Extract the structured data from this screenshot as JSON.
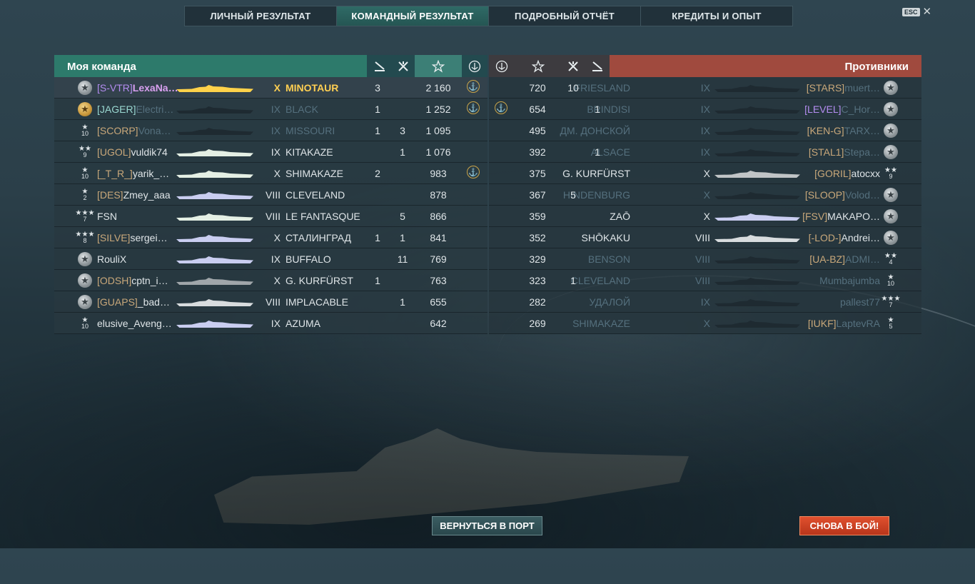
{
  "tabs": [
    {
      "label": "ЛИЧНЫЙ РЕЗУЛЬТАТ",
      "active": false
    },
    {
      "label": "КОМАНДНЫЙ РЕЗУЛЬТАТ",
      "active": true
    },
    {
      "label": "ПОДРОБНЫЙ ОТЧЁТ",
      "active": false
    },
    {
      "label": "КРЕДИТЫ И ОПЫТ",
      "active": false
    }
  ],
  "esc": {
    "key": "ESC",
    "close": "✕"
  },
  "my_team": {
    "title": "Моя команда",
    "columns": [
      "torpedo-hits-icon",
      "planes-shot-icon",
      "star-xp-icon",
      "anchor-icon"
    ],
    "rows": [
      {
        "rank": "",
        "medal": "silver",
        "clan": "[S-VTR]",
        "clan_color": "purple",
        "nick": "LexaNa…",
        "nick_style": "me",
        "ship_color": "#ffd24a",
        "tier": "X",
        "ship": "MINOTAUR",
        "ship_style": "gold",
        "c1": "3",
        "c2": "",
        "xp": "2 160",
        "anchor": true,
        "me": true
      },
      {
        "rank": "",
        "medal": "gold",
        "clan": "[JAGER]",
        "clan_color": "teal",
        "nick": "Electri…",
        "nick_style": "dim",
        "ship_color": "#1e2a31",
        "tier": "IX",
        "ship": "BLACK",
        "ship_style": "dim",
        "c1": "1",
        "c2": "",
        "xp": "1 252",
        "anchor": true
      },
      {
        "rank": "10",
        "medal": "star1",
        "clan": "[SCORP]",
        "clan_color": "orange",
        "nick": "Vona…",
        "nick_style": "dim",
        "ship_color": "#1e2a31",
        "tier": "IX",
        "ship": "MISSOURI",
        "ship_style": "dim",
        "c1": "1",
        "c2": "3",
        "xp": "1 095",
        "anchor": false
      },
      {
        "rank": "9",
        "medal": "star2",
        "clan": "[UGOL]",
        "clan_color": "orange",
        "nick": "vuldik74",
        "nick_style": "",
        "ship_color": "#e4efe4",
        "tier": "IX",
        "ship": "KITAKAZE",
        "ship_style": "",
        "c1": "",
        "c2": "1",
        "xp": "1 076",
        "anchor": false
      },
      {
        "rank": "10",
        "medal": "star1",
        "clan": "[_T_R_]",
        "clan_color": "",
        "nick": "yarik_…",
        "nick_style": "",
        "ship_color": "#e4efe4",
        "tier": "X",
        "ship": "SHIMAKAZE",
        "ship_style": "",
        "c1": "2",
        "c2": "",
        "xp": "983",
        "anchor": true
      },
      {
        "rank": "2",
        "medal": "star1",
        "clan": "[DES]",
        "clan_color": "orange",
        "nick": "Zmey_aaa",
        "nick_style": "",
        "ship_color": "#c9cdf0",
        "tier": "VIII",
        "ship": "CLEVELAND",
        "ship_style": "",
        "c1": "",
        "c2": "",
        "xp": "878",
        "anchor": false
      },
      {
        "rank": "7",
        "medal": "star3",
        "clan": "",
        "clan_color": "",
        "nick": "FSN",
        "nick_style": "",
        "ship_color": "#e4efe4",
        "tier": "VIII",
        "ship": "LE FANTASQUE",
        "ship_style": "",
        "c1": "",
        "c2": "5",
        "xp": "866",
        "anchor": false
      },
      {
        "rank": "8",
        "medal": "star3",
        "clan": "[SILVE]",
        "clan_color": "orange",
        "nick": "sergei…",
        "nick_style": "",
        "ship_color": "#c9cdf0",
        "tier": "X",
        "ship": "СТАЛИНГРАД",
        "ship_style": "",
        "c1": "1",
        "c2": "1",
        "xp": "841",
        "anchor": false
      },
      {
        "rank": "",
        "medal": "silver",
        "clan": "",
        "clan_color": "",
        "nick": "RouliX",
        "nick_style": "",
        "ship_color": "#c9cdf0",
        "tier": "IX",
        "ship": "BUFFALO",
        "ship_style": "",
        "c1": "",
        "c2": "11",
        "xp": "769",
        "anchor": false
      },
      {
        "rank": "",
        "medal": "silver",
        "clan": "[ODSH]",
        "clan_color": "orange",
        "nick": "cptn_i…",
        "nick_style": "",
        "ship_color": "#a0a6aa",
        "tier": "X",
        "ship": "G. KURFÜRST",
        "ship_style": "",
        "c1": "1",
        "c2": "",
        "xp": "763",
        "anchor": false
      },
      {
        "rank": "",
        "medal": "silver",
        "clan": "[GUAPS]",
        "clan_color": "orange",
        "nick": "_bad…",
        "nick_style": "",
        "ship_color": "#d8dcde",
        "tier": "VIII",
        "ship": "IMPLACABLE",
        "ship_style": "",
        "c1": "",
        "c2": "1",
        "xp": "655",
        "anchor": false
      },
      {
        "rank": "10",
        "medal": "star1",
        "clan": "",
        "clan_color": "",
        "nick": "elusive_Aveng…",
        "nick_style": "",
        "ship_color": "#c9cdf0",
        "tier": "IX",
        "ship": "AZUMA",
        "ship_style": "",
        "c1": "",
        "c2": "",
        "xp": "642",
        "anchor": false
      }
    ]
  },
  "enemy_team": {
    "title": "Противники",
    "columns": [
      "anchor-icon",
      "star-xp-icon",
      "planes-shot-icon",
      "torpedo-hits-icon"
    ],
    "rows": [
      {
        "rank": "",
        "medal": "silver",
        "clan": "[STARS]",
        "clan_color": "orange",
        "nick": "muert…",
        "nick_style": "dim",
        "ship_color": "#1e2a31",
        "tier": "IX",
        "ship": "FRIESLAND",
        "ship_style": "dim",
        "c1": "10",
        "c2": "",
        "xp": "720",
        "anchor": false
      },
      {
        "rank": "",
        "medal": "silver",
        "clan": "[LEVEL]",
        "clan_color": "purple",
        "nick": "C_Hor…",
        "nick_style": "dim",
        "ship_color": "#1e2a31",
        "tier": "IX",
        "ship": "BRINDISI",
        "ship_style": "dim",
        "c1": "",
        "c2": "1",
        "xp": "654",
        "anchor": true
      },
      {
        "rank": "",
        "medal": "silver",
        "clan": "[KEN-G]",
        "clan_color": "orange",
        "nick": "TARX…",
        "nick_style": "dim",
        "ship_color": "#1e2a31",
        "tier": "IX",
        "ship": "ДМ. ДОНСКОЙ",
        "ship_style": "dim",
        "c1": "",
        "c2": "",
        "xp": "495",
        "anchor": false
      },
      {
        "rank": "",
        "medal": "silver",
        "clan": "[STAL1]",
        "clan_color": "",
        "nick": "Stepa…",
        "nick_style": "dim",
        "ship_color": "#1e2a31",
        "tier": "IX",
        "ship": "ALSACE",
        "ship_style": "dim",
        "c1": "",
        "c2": "1",
        "xp": "392",
        "anchor": false
      },
      {
        "rank": "9",
        "medal": "star2",
        "clan": "[GORIL]",
        "clan_color": "orange",
        "nick": "atocxx",
        "nick_style": "",
        "ship_color": "#c0c4c6",
        "tier": "X",
        "ship": "G. KURFÜRST",
        "ship_style": "",
        "c1": "",
        "c2": "",
        "xp": "375",
        "anchor": false
      },
      {
        "rank": "",
        "medal": "silver",
        "clan": "[SLOOP]",
        "clan_color": "",
        "nick": "Volod…",
        "nick_style": "dim",
        "ship_color": "#1e2a31",
        "tier": "X",
        "ship": "HINDENBURG",
        "ship_style": "dim",
        "c1": "5",
        "c2": "",
        "xp": "367",
        "anchor": false
      },
      {
        "rank": "",
        "medal": "silver",
        "clan": "[FSV]",
        "clan_color": "orange",
        "nick": "MAKAPO…",
        "nick_style": "",
        "ship_color": "#c9cdf0",
        "tier": "X",
        "ship": "ZAŌ",
        "ship_style": "",
        "c1": "",
        "c2": "",
        "xp": "359",
        "anchor": false
      },
      {
        "rank": "",
        "medal": "silver",
        "clan": "[-LOD-]",
        "clan_color": "orange",
        "nick": "Andrei…",
        "nick_style": "",
        "ship_color": "#d8dcde",
        "tier": "VIII",
        "ship": "SHŌKAKU",
        "ship_style": "",
        "c1": "",
        "c2": "",
        "xp": "352",
        "anchor": false
      },
      {
        "rank": "4",
        "medal": "star2",
        "clan": "[UA-BZ]",
        "clan_color": "orange",
        "nick": "ADMI…",
        "nick_style": "dim",
        "ship_color": "#1e2a31",
        "tier": "VIII",
        "ship": "BENSON",
        "ship_style": "dim",
        "c1": "",
        "c2": "",
        "xp": "329",
        "anchor": false
      },
      {
        "rank": "10",
        "medal": "star1",
        "clan": "",
        "clan_color": "",
        "nick": "Mumbajumba",
        "nick_style": "dim",
        "ship_color": "#1e2a31",
        "tier": "VIII",
        "ship": "CLEVELAND",
        "ship_style": "dim",
        "c1": "1",
        "c2": "",
        "xp": "323",
        "anchor": false
      },
      {
        "rank": "7",
        "medal": "star3",
        "clan": "",
        "clan_color": "",
        "nick": "pallest77",
        "nick_style": "dim",
        "ship_color": "#1e2a31",
        "tier": "IX",
        "ship": "УДАЛОЙ",
        "ship_style": "dim",
        "c1": "",
        "c2": "",
        "xp": "282",
        "anchor": false
      },
      {
        "rank": "5",
        "medal": "star1",
        "clan": "[IUKF]",
        "clan_color": "",
        "nick": "LaptevRA",
        "nick_style": "dim",
        "ship_color": "#1e2a31",
        "tier": "X",
        "ship": "SHIMAKAZE",
        "ship_style": "dim",
        "c1": "",
        "c2": "",
        "xp": "269",
        "anchor": false
      }
    ]
  },
  "buttons": {
    "port": "ВЕРНУТЬСЯ В ПОРТ",
    "battle": "СНОВА В БОЙ!"
  },
  "colors": {
    "my_header": "#2d7a6b",
    "enemy_header": "#a04a3e",
    "gold": "#ffcf52",
    "battle_button": "#d44a2a"
  }
}
